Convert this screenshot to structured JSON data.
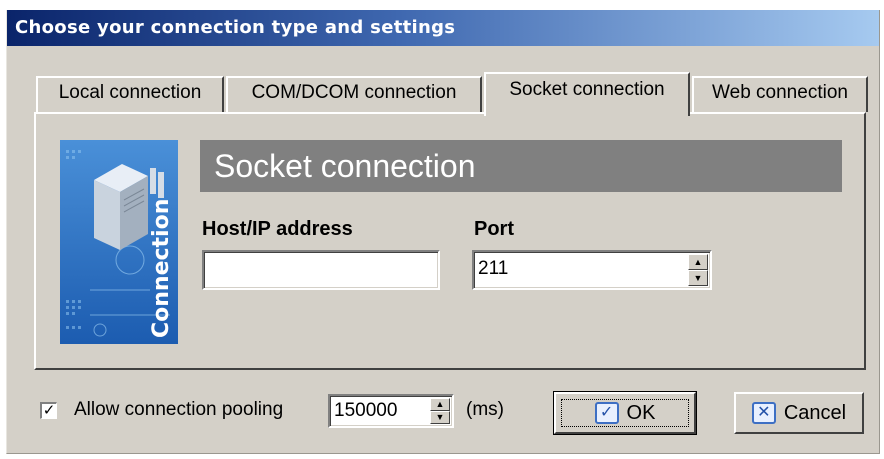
{
  "dialog": {
    "title": "Choose your connection type and settings"
  },
  "tabs": [
    {
      "label": "Local connection",
      "active": false
    },
    {
      "label": "COM/DCOM connection",
      "active": false
    },
    {
      "label": "Socket connection",
      "active": true
    },
    {
      "label": "Web connection",
      "active": false
    }
  ],
  "panel": {
    "banner_text": "Connection",
    "header": "Socket connection",
    "host": {
      "label": "Host/IP address",
      "value": ""
    },
    "port": {
      "label": "Port",
      "value": "211"
    }
  },
  "footer": {
    "pooling_checked": true,
    "pooling_label": "Allow connection pooling",
    "pooling_value": "150000",
    "units": "(ms)",
    "ok_label": "OK",
    "cancel_label": "Cancel"
  },
  "colors": {
    "titlebar_start": "#0a246a",
    "titlebar_end": "#a6caf0",
    "header_bar": "#808080",
    "face": "#d4d0c8",
    "icon_blue": "#3d6fc4"
  }
}
